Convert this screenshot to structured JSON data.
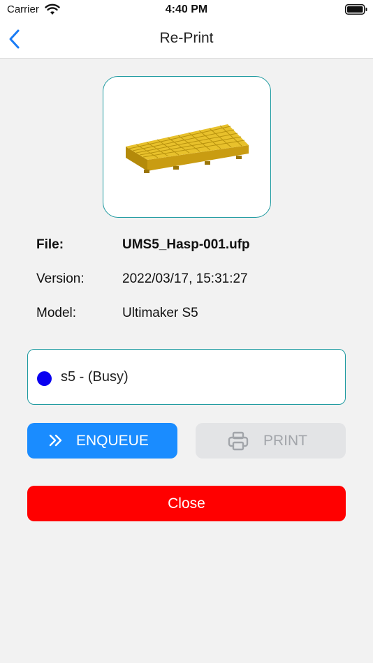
{
  "status_bar": {
    "carrier": "Carrier",
    "time": "4:40 PM"
  },
  "nav": {
    "title": "Re-Print",
    "back_icon": "chevron-left-icon"
  },
  "file_info": {
    "file_label": "File:",
    "file_value": "UMS5_Hasp-001.ufp",
    "version_label": "Version:",
    "version_value": "2022/03/17, 15:31:27",
    "model_label": "Model:",
    "model_value": "Ultimaker S5"
  },
  "printer_select": {
    "selected": "s5 - (Busy)",
    "status_color": "#0a00f0"
  },
  "buttons": {
    "enqueue_label": "ENQUEUE",
    "enqueue_icon": "double-chevron-right-icon",
    "print_label": "PRINT",
    "print_icon": "printer-icon",
    "print_enabled": false,
    "close_label": "Close"
  },
  "colors": {
    "accent": "#1a8cff",
    "border_teal": "#1e9aa0",
    "danger": "#ff0000",
    "disabled": "#e3e4e6"
  }
}
